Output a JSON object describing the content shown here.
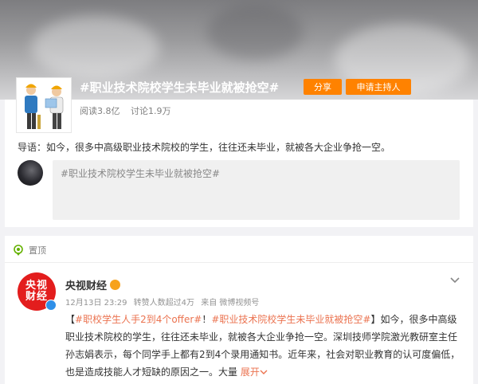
{
  "topic": {
    "title": "#职业技术院校学生未毕业就被抢空#",
    "share_label": "分享",
    "host_label": "申请主持人",
    "reads": "阅读3.8亿",
    "discussions": "讨论1.9万",
    "intro": "导语：如今，很多中高级职业技术院校的学生，往往还未毕业，就被各大企业争抢一空。",
    "compose_placeholder": "#职业技术院校学生未毕业就被抢空#"
  },
  "feed": {
    "pinned_label": "置顶",
    "post": {
      "avatar_text": [
        "央视",
        "财经"
      ],
      "author": "央视财经",
      "date": "12月13日 23:29",
      "likes": "转赞人数超过4万",
      "source": "来自 微博视频号",
      "tag1": "#职校学生人手2到4个offer#",
      "exclamation": "！",
      "tag2": "#职业技术院校学生未毕业就被抢空#",
      "body": "】如今，很多中高级职业技术院校的学生，往往还未毕业，就被各大企业争抢一空。深圳技师学院激光教研室主任孙志娟表示，每个同学手上都有2到4个录用通知书。近年来，社会对职业教育的认可度偏低，也是造成技能人才短缺的原因之一。大量",
      "open_bracket": "【",
      "expand_label": "展开"
    }
  },
  "colors": {
    "accent": "#ff8200",
    "link": "#eb7350",
    "brand_red": "#e31d1d",
    "verify_blue": "#2f8fe8"
  },
  "icons": [
    "pin-icon",
    "verified-icon",
    "crown-icon",
    "chevron-down-icon",
    "expand-chevron-icon"
  ]
}
